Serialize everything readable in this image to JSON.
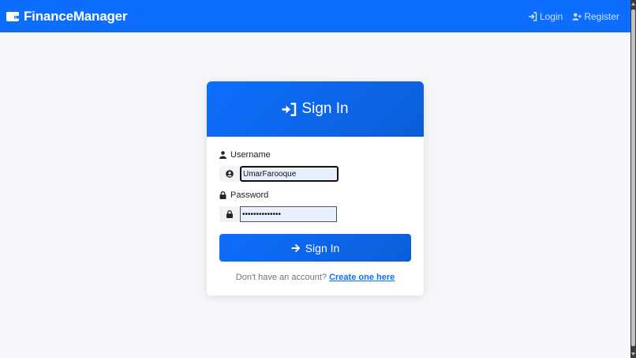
{
  "navbar": {
    "brand": "FinanceManager",
    "brand_icon": "wallet-icon",
    "links": [
      {
        "label": "Login",
        "icon": "login-icon"
      },
      {
        "label": "Register",
        "icon": "user-plus-icon"
      }
    ],
    "color": "#0d6efd"
  },
  "login_card": {
    "title": "Sign In",
    "title_icon": "sign-in-icon",
    "username": {
      "label": "Username",
      "label_icon": "user-icon",
      "addon_icon": "user-circle-icon",
      "value": "UmarFarooque"
    },
    "password": {
      "label": "Password",
      "label_icon": "lock-icon",
      "addon_icon": "lock-icon",
      "value": "••••••••••••••"
    },
    "submit_label": "Sign In",
    "submit_icon": "arrow-right-icon",
    "footer_text": "Don't have an account?",
    "footer_link": "Create one here"
  }
}
